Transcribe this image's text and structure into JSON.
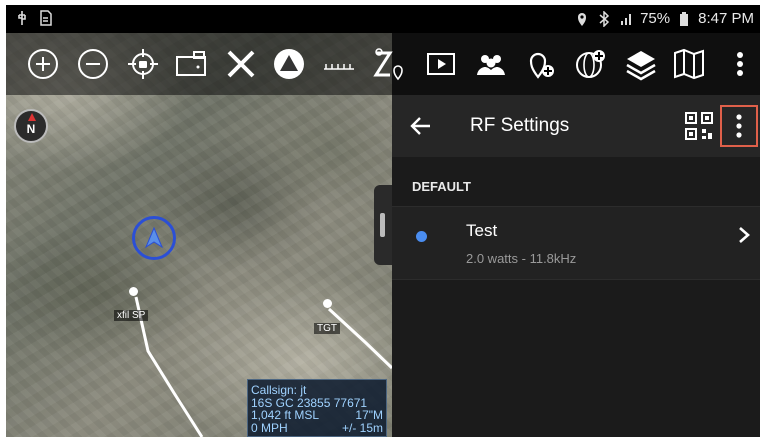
{
  "status_bar": {
    "battery": "75%",
    "time": "8:47 PM"
  },
  "toolbar": {
    "icons": [
      "zoom-in-icon",
      "zoom-out-icon",
      "locate-icon",
      "camera-icon",
      "close-icon",
      "shield-icon",
      "measure-icon",
      "route-icon",
      "video-icon",
      "contacts-icon",
      "add-point-icon",
      "globe-add-icon",
      "layers-icon",
      "map-icon",
      "overflow-icon"
    ]
  },
  "map": {
    "compass_label": "N",
    "labels": {
      "xfil": "xfil SP",
      "tgt": "TGT"
    },
    "info": {
      "callsign": "Callsign: jt",
      "grid": "16S  GC  23855  77671",
      "alt": "1,042 ft MSL",
      "alt_right": "17\"M",
      "speed": "0 MPH",
      "accuracy": "+/- 15m"
    }
  },
  "panel": {
    "title": "RF Settings",
    "section_label": "DEFAULT",
    "item": {
      "name": "Test",
      "detail": "2.0 watts - 11.8kHz",
      "bullet_color": "#4a8df0"
    }
  },
  "colors": {
    "highlight": "#e0604a",
    "accent": "#2b4fd6"
  }
}
